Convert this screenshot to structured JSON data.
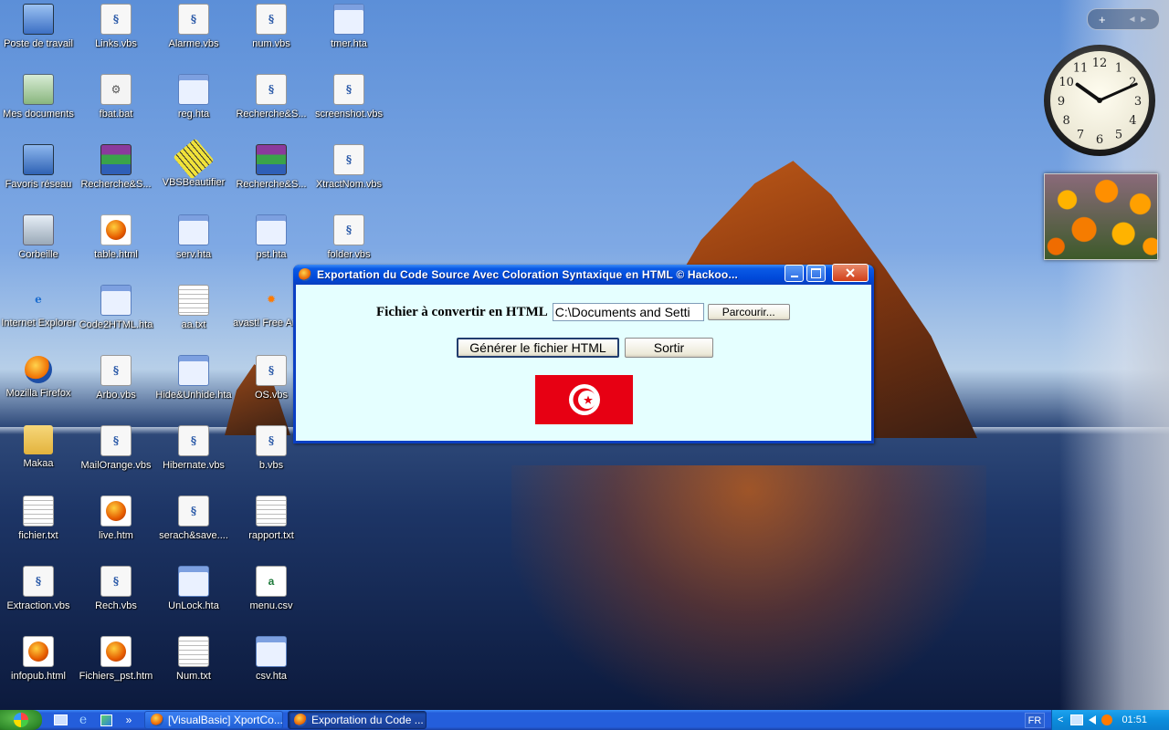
{
  "desktop_icons": [
    {
      "label": "Poste de travail",
      "icon": "my-computer-icon"
    },
    {
      "label": "Links.vbs",
      "icon": "vbs-script-icon"
    },
    {
      "label": "Alarme.vbs",
      "icon": "vbs-script-icon"
    },
    {
      "label": "num.vbs",
      "icon": "vbs-script-icon"
    },
    {
      "label": "tmer.hta",
      "icon": "hta-file-icon"
    },
    {
      "label": "Mes documents",
      "icon": "my-documents-icon"
    },
    {
      "label": "fbat.bat",
      "icon": "batch-file-icon"
    },
    {
      "label": "reg.hta",
      "icon": "hta-file-icon"
    },
    {
      "label": "Recherche&S...",
      "icon": "vbs-script-icon"
    },
    {
      "label": "screenshot.vbs",
      "icon": "vbs-script-icon"
    },
    {
      "label": "Favoris réseau",
      "icon": "network-places-icon"
    },
    {
      "label": "Recherche&S...",
      "icon": "rar-archive-icon"
    },
    {
      "label": "VBSBeautifier",
      "icon": "ruler-icon"
    },
    {
      "label": "Recherche&S...",
      "icon": "rar-archive-icon"
    },
    {
      "label": "XtractNom.vbs",
      "icon": "vbs-script-icon"
    },
    {
      "label": "Corbeille",
      "icon": "recycle-bin-icon"
    },
    {
      "label": "table.html",
      "icon": "html-file-icon"
    },
    {
      "label": "serv.hta",
      "icon": "hta-file-icon"
    },
    {
      "label": "pst.hta",
      "icon": "hta-file-icon"
    },
    {
      "label": "folder.vbs",
      "icon": "vbs-script-icon"
    },
    {
      "label": "Internet Explorer",
      "icon": "internet-explorer-icon"
    },
    {
      "label": "Code2HTML.hta",
      "icon": "hta-file-icon"
    },
    {
      "label": "aa.txt",
      "icon": "text-file-icon"
    },
    {
      "label": "avast! Free Antivirus",
      "icon": "avast-icon"
    },
    {
      "label": "Mozilla Firefox",
      "icon": "firefox-icon"
    },
    {
      "label": "Arbo.vbs",
      "icon": "vbs-script-icon"
    },
    {
      "label": "Hide&Unhide.hta",
      "icon": "hta-file-icon"
    },
    {
      "label": "OS.vbs",
      "icon": "vbs-script-icon"
    },
    {
      "label": "Makaa",
      "icon": "folder-icon"
    },
    {
      "label": "MailOrange.vbs",
      "icon": "vbs-script-icon"
    },
    {
      "label": "Hibernate.vbs",
      "icon": "vbs-script-icon"
    },
    {
      "label": "b.vbs",
      "icon": "vbs-script-icon"
    },
    {
      "label": "fichier.txt",
      "icon": "text-file-icon"
    },
    {
      "label": "live.htm",
      "icon": "html-file-icon"
    },
    {
      "label": "serach&save....",
      "icon": "vbs-script-icon"
    },
    {
      "label": "rapport.txt",
      "icon": "text-file-icon"
    },
    {
      "label": "Extraction.vbs",
      "icon": "vbs-script-icon"
    },
    {
      "label": "Rech.vbs",
      "icon": "vbs-script-icon"
    },
    {
      "label": "UnLock.hta",
      "icon": "hta-file-icon"
    },
    {
      "label": "menu.csv",
      "icon": "csv-file-icon"
    },
    {
      "label": "infopub.html",
      "icon": "html-file-icon"
    },
    {
      "label": "Fichiers_pst.htm",
      "icon": "html-file-icon"
    },
    {
      "label": "Num.txt",
      "icon": "text-file-icon"
    },
    {
      "label": "csv.hta",
      "icon": "hta-file-icon"
    }
  ],
  "dialog": {
    "title": "Exportation du Code Source Avec Coloration Syntaxique en HTML © Hackoo...",
    "file_label": "Fichier à convertir en HTML",
    "file_value": "C:\\Documents and Setti",
    "browse_label": "Parcourir...",
    "generate_label": "Générer le fichier HTML",
    "quit_label": "Sortir",
    "flag_colors": {
      "background": "#e70013",
      "emblem": "#ffffff"
    }
  },
  "gadgets": {
    "clock_time": "10:11",
    "clock_numbers": [
      "12",
      "1",
      "2",
      "3",
      "4",
      "5",
      "6",
      "7",
      "8",
      "9",
      "10",
      "11"
    ],
    "add_gadget": "+",
    "nav_arrows": "◄ ►"
  },
  "taskbar": {
    "tasks": [
      {
        "label": "[VisualBasic] XportCo..."
      },
      {
        "label": "Exportation du Code ..."
      }
    ],
    "quick_launch_more": "»",
    "language": "FR",
    "tray_expand": "<",
    "time": "01:51"
  }
}
